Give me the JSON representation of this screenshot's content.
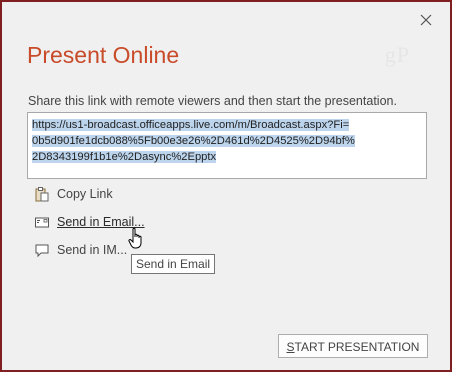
{
  "dialog": {
    "title": "Present Online",
    "watermark": "gP",
    "instructions": "Share this link with remote viewers and then start the presentation.",
    "link_lines": [
      "https://us1-broadcast.officeapps.live.com/m/Broadcast.aspx?Fi=",
      "0b5d901fe1dcb088%5Fb00e3e26%2D461d%2D4525%2D94bf%",
      "2D8343199f1b1e%2Dasync%2Epptx"
    ],
    "actions": {
      "copy_link": "Copy Link",
      "send_email": "Send in Email...",
      "send_im": "Send in IM..."
    },
    "tooltip": "Send in Email",
    "start_button": {
      "mnemonic": "S",
      "rest": "TART PRESENTATION"
    }
  },
  "colors": {
    "title": "#c84b2a",
    "border": "#7f1f1f",
    "selection": "#bcd4ec",
    "background": "#f0f0f0"
  },
  "icons": [
    "close-icon",
    "clipboard-icon",
    "email-icon",
    "chat-icon",
    "hand-cursor-icon"
  ]
}
